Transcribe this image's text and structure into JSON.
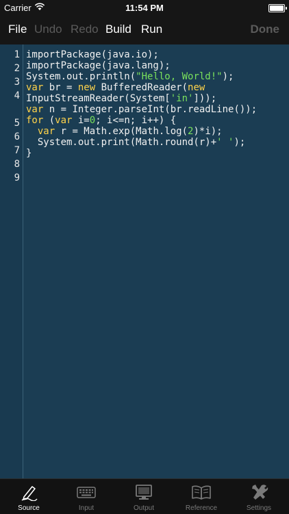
{
  "status": {
    "carrier": "Carrier",
    "time": "11:54 PM"
  },
  "toolbar": {
    "file": "File",
    "undo": "Undo",
    "redo": "Redo",
    "build": "Build",
    "run": "Run",
    "done": "Done"
  },
  "editor": {
    "line_numbers": [
      "1",
      "2",
      "3",
      "4",
      "5",
      "6",
      "7",
      "8",
      "9"
    ],
    "lines": [
      "importPackage(java.io);",
      "importPackage(java.lang);",
      "System.out.println(\"Hello, World!\");",
      "var br = new BufferedReader(new",
      "InputStreamReader(System['in']));",
      "var n = Integer.parseInt(br.readLine());",
      "for (var i=0; i<=n; i++) {",
      "  var r = Math.exp(Math.log(2)*i);",
      "  System.out.print(Math.round(r)+' ');",
      "}"
    ]
  },
  "tabs": [
    {
      "label": "Source",
      "icon": "pen-icon",
      "active": true
    },
    {
      "label": "Input",
      "icon": "keyboard-icon",
      "active": false
    },
    {
      "label": "Output",
      "icon": "monitor-icon",
      "active": false
    },
    {
      "label": "Reference",
      "icon": "book-icon",
      "active": false
    },
    {
      "label": "Settings",
      "icon": "tools-icon",
      "active": false
    }
  ],
  "colors": {
    "editor_bg": "#1b3d53",
    "keyword": "#ffd34a",
    "string": "#79e05c",
    "bar_bg": "#161616"
  }
}
